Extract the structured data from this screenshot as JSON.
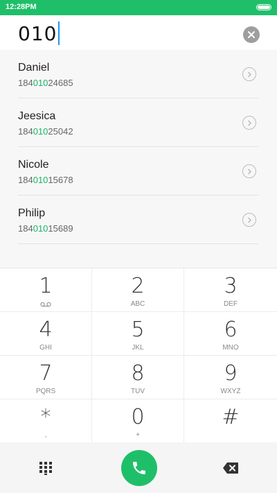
{
  "status": {
    "time": "12:28PM"
  },
  "dialer": {
    "input_value": "010"
  },
  "contacts": [
    {
      "name": "Daniel",
      "number_pre": "184",
      "number_match": "010",
      "number_post": "24685"
    },
    {
      "name": "Jeesica",
      "number_pre": "184",
      "number_match": "010",
      "number_post": "25042"
    },
    {
      "name": "Nicole",
      "number_pre": "184",
      "number_match": "010",
      "number_post": "15678"
    },
    {
      "name": "Philip",
      "number_pre": "184",
      "number_match": "010",
      "number_post": "15689"
    }
  ],
  "keypad": [
    {
      "digit": "1",
      "sub": "voicemail-icon"
    },
    {
      "digit": "2",
      "sub": "ABC"
    },
    {
      "digit": "3",
      "sub": "DEF"
    },
    {
      "digit": "4",
      "sub": "GHI"
    },
    {
      "digit": "5",
      "sub": "JKL"
    },
    {
      "digit": "6",
      "sub": "MNO"
    },
    {
      "digit": "7",
      "sub": "PQRS"
    },
    {
      "digit": "8",
      "sub": "TUV"
    },
    {
      "digit": "9",
      "sub": "WXYZ"
    },
    {
      "digit": "*",
      "sub": ","
    },
    {
      "digit": "0",
      "sub": "+"
    },
    {
      "digit": "#",
      "sub": ""
    }
  ],
  "colors": {
    "accent": "#1fbf6a",
    "highlight": "#1fb46a",
    "cursor": "#2196f3"
  }
}
